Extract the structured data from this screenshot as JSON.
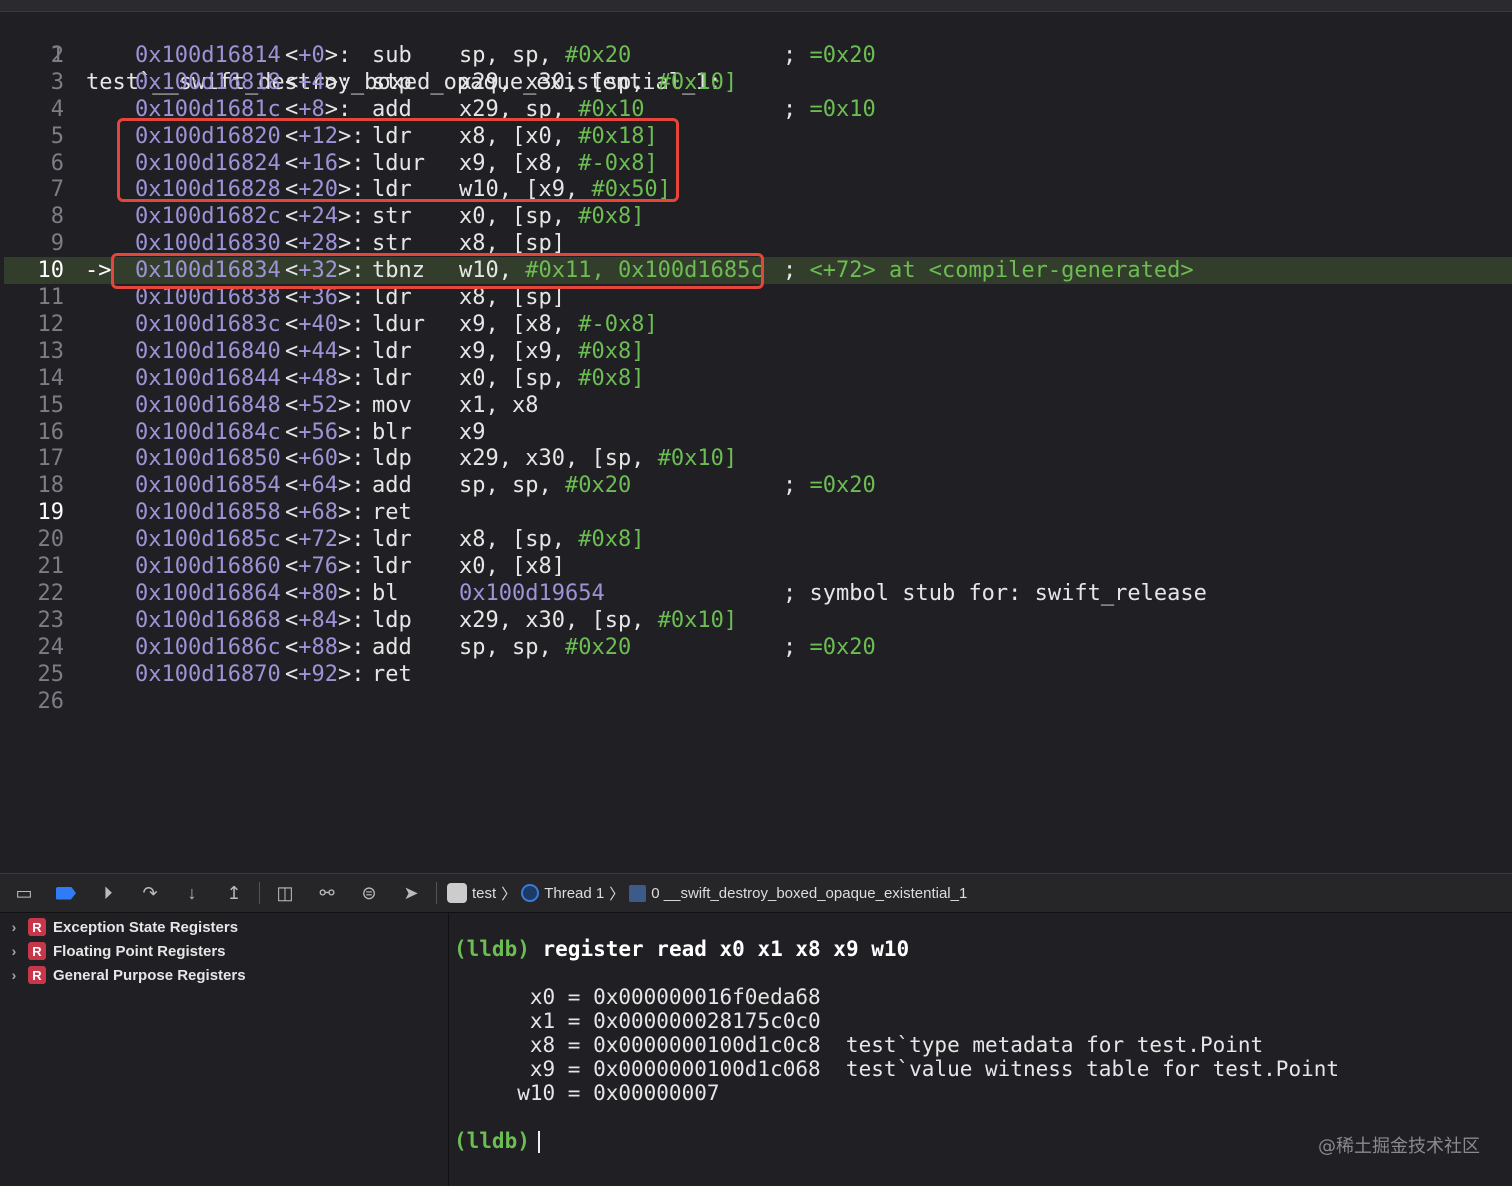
{
  "symbol_line": {
    "n": "1",
    "text": "test`__swift_destroy_boxed_opaque_existential_1:"
  },
  "current_line": "10",
  "arrow": "->",
  "rows": [
    {
      "n": "2",
      "addr": "0x100d16814",
      "off": "+0",
      "mn": "sub",
      "ops": [
        [
          "sp, sp, ",
          0
        ],
        [
          "#0x20",
          1
        ]
      ],
      "cm": [
        [
          "; =0x20",
          1
        ]
      ]
    },
    {
      "n": "3",
      "addr": "0x100d16818",
      "off": "+4",
      "mn": "stp",
      "ops": [
        [
          "x29, x30, [sp, ",
          0
        ],
        [
          "#0x10]",
          1
        ]
      ],
      "cm": []
    },
    {
      "n": "4",
      "addr": "0x100d1681c",
      "off": "+8",
      "mn": "add",
      "ops": [
        [
          "x29, sp, ",
          0
        ],
        [
          "#0x10",
          1
        ]
      ],
      "cm": [
        [
          "; =0x10",
          1
        ]
      ]
    },
    {
      "n": "5",
      "addr": "0x100d16820",
      "off": "+12",
      "mn": "ldr",
      "ops": [
        [
          "x8, [x0, ",
          0
        ],
        [
          "#0x18]",
          1
        ]
      ],
      "cm": []
    },
    {
      "n": "6",
      "addr": "0x100d16824",
      "off": "+16",
      "mn": "ldur",
      "ops": [
        [
          "x9, [x8, ",
          0
        ],
        [
          "#-0x8]",
          1
        ]
      ],
      "cm": []
    },
    {
      "n": "7",
      "addr": "0x100d16828",
      "off": "+20",
      "mn": "ldr",
      "ops": [
        [
          "w10, [x9, ",
          0
        ],
        [
          "#0x50]",
          1
        ]
      ],
      "cm": []
    },
    {
      "n": "8",
      "addr": "0x100d1682c",
      "off": "+24",
      "mn": "str",
      "ops": [
        [
          "x0, [sp, ",
          0
        ],
        [
          "#0x8]",
          1
        ]
      ],
      "cm": []
    },
    {
      "n": "9",
      "addr": "0x100d16830",
      "off": "+28",
      "mn": "str",
      "ops": [
        [
          "x8, [sp]",
          0
        ]
      ],
      "cm": []
    },
    {
      "n": "10",
      "addr": "0x100d16834",
      "off": "+32",
      "mn": "tbnz",
      "ops": [
        [
          "w10, ",
          0
        ],
        [
          "#0x11, 0x100d1685c",
          1
        ]
      ],
      "cm": [
        [
          "; <+72> at <compiler-generated>",
          1
        ]
      ]
    },
    {
      "n": "11",
      "addr": "0x100d16838",
      "off": "+36",
      "mn": "ldr",
      "ops": [
        [
          "x8, [sp]",
          0
        ]
      ],
      "cm": []
    },
    {
      "n": "12",
      "addr": "0x100d1683c",
      "off": "+40",
      "mn": "ldur",
      "ops": [
        [
          "x9, [x8, ",
          0
        ],
        [
          "#-0x8]",
          1
        ]
      ],
      "cm": []
    },
    {
      "n": "13",
      "addr": "0x100d16840",
      "off": "+44",
      "mn": "ldr",
      "ops": [
        [
          "x9, [x9, ",
          0
        ],
        [
          "#0x8]",
          1
        ]
      ],
      "cm": []
    },
    {
      "n": "14",
      "addr": "0x100d16844",
      "off": "+48",
      "mn": "ldr",
      "ops": [
        [
          "x0, [sp, ",
          0
        ],
        [
          "#0x8]",
          1
        ]
      ],
      "cm": []
    },
    {
      "n": "15",
      "addr": "0x100d16848",
      "off": "+52",
      "mn": "mov",
      "ops": [
        [
          "x1, x8",
          0
        ]
      ],
      "cm": []
    },
    {
      "n": "16",
      "addr": "0x100d1684c",
      "off": "+56",
      "mn": "blr",
      "ops": [
        [
          "x9",
          0
        ]
      ],
      "cm": []
    },
    {
      "n": "17",
      "addr": "0x100d16850",
      "off": "+60",
      "mn": "ldp",
      "ops": [
        [
          "x29, x30, [sp, ",
          0
        ],
        [
          "#0x10]",
          1
        ]
      ],
      "cm": []
    },
    {
      "n": "18",
      "addr": "0x100d16854",
      "off": "+64",
      "mn": "add",
      "ops": [
        [
          "sp, sp, ",
          0
        ],
        [
          "#0x20",
          1
        ]
      ],
      "cm": [
        [
          "; =0x20",
          1
        ]
      ]
    },
    {
      "n": "19",
      "addr": "0x100d16858",
      "off": "+68",
      "mn": "ret",
      "ops": [],
      "cm": []
    },
    {
      "n": "20",
      "addr": "0x100d1685c",
      "off": "+72",
      "mn": "ldr",
      "ops": [
        [
          "x8, [sp, ",
          0
        ],
        [
          "#0x8]",
          1
        ]
      ],
      "cm": []
    },
    {
      "n": "21",
      "addr": "0x100d16860",
      "off": "+76",
      "mn": "ldr",
      "ops": [
        [
          "x0, [x8]",
          0
        ]
      ],
      "cm": []
    },
    {
      "n": "22",
      "addr": "0x100d16864",
      "off": "+80",
      "mn": "bl",
      "ops": [
        [
          "0x100d19654",
          2
        ]
      ],
      "cm": [
        [
          "; symbol stub for: swift_release",
          0
        ]
      ]
    },
    {
      "n": "23",
      "addr": "0x100d16868",
      "off": "+84",
      "mn": "ldp",
      "ops": [
        [
          "x29, x30, [sp, ",
          0
        ],
        [
          "#0x10]",
          1
        ]
      ],
      "cm": []
    },
    {
      "n": "24",
      "addr": "0x100d1686c",
      "off": "+88",
      "mn": "add",
      "ops": [
        [
          "sp, sp, ",
          0
        ],
        [
          "#0x20",
          1
        ]
      ],
      "cm": [
        [
          "; =0x20",
          1
        ]
      ]
    },
    {
      "n": "25",
      "addr": "0x100d16870",
      "off": "+92",
      "mn": "ret",
      "ops": [],
      "cm": []
    }
  ],
  "last_line": "26",
  "debug_bar": {
    "target": "test",
    "thread": "Thread 1",
    "frame": "0 __swift_destroy_boxed_opaque_existential_1"
  },
  "register_groups": [
    "Exception State Registers",
    "Floating Point Registers",
    "General Purpose Registers"
  ],
  "register_badge": "R",
  "console": {
    "prompt": "(lldb)",
    "command": "register read x0 x1 x8 x9 w10",
    "output": [
      "      x0 = 0x000000016f0eda68",
      "      x1 = 0x000000028175c0c0",
      "      x8 = 0x0000000100d1c0c8  test`type metadata for test.Point",
      "      x9 = 0x0000000100d1c068  test`value witness table for test.Point",
      "     w10 = 0x00000007"
    ]
  },
  "watermark": "@稀土掘金技术社区"
}
